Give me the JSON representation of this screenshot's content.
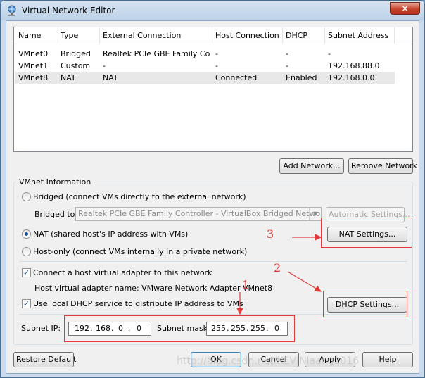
{
  "window": {
    "title": "Virtual Network Editor",
    "close_label": "×"
  },
  "table": {
    "columns": [
      "Name",
      "Type",
      "External Connection",
      "Host Connection",
      "DHCP",
      "Subnet Address"
    ],
    "rows": [
      [
        "VMnet0",
        "Bridged",
        "Realtek PCIe GBE Family Co...",
        "-",
        "-",
        "-"
      ],
      [
        "VMnet1",
        "Custom",
        "-",
        "-",
        "-",
        "192.168.88.0"
      ],
      [
        "VMnet8",
        "NAT",
        "NAT",
        "Connected",
        "Enabled",
        "192.168.0.0"
      ]
    ]
  },
  "buttons": {
    "add_network": "Add Network...",
    "remove_network": "Remove Network",
    "automatic_settings": "Automatic Settings...",
    "nat_settings": "NAT Settings...",
    "dhcp_settings": "DHCP Settings...",
    "restore_default": "Restore Default",
    "ok": "OK",
    "cancel": "Cancel",
    "apply": "Apply",
    "help": "Help"
  },
  "vmnet_info": {
    "group_label": "VMnet Information",
    "bridged_label": "Bridged (connect VMs directly to the external network)",
    "bridged_to_label": "Bridged to:",
    "bridged_to_value": "Realtek PCIe GBE Family Controller - VirtualBox Bridged Networking",
    "nat_label": "NAT (shared host's IP address with VMs)",
    "hostonly_label": "Host-only (connect VMs internally in a private network)",
    "connect_adapter_label": "Connect a host virtual adapter to this network",
    "adapter_name_label": "Host virtual adapter name: VMware Network Adapter VMnet8",
    "dhcp_label": "Use local DHCP service to distribute IP address to VMs",
    "subnet_ip_label": "Subnet IP:",
    "subnet_ip": [
      "192",
      "168",
      "0",
      "0"
    ],
    "subnet_mask_label": "Subnet mask:",
    "subnet_mask": [
      "255",
      "255",
      "255",
      "0"
    ],
    "selected_mode": "NAT",
    "connect_adapter_checked": true,
    "dhcp_checked": true
  },
  "annotations": {
    "one": "1",
    "two": "2",
    "three": "3",
    "color": "#e23a3a"
  },
  "watermark": "http://blog.csdn.net/KEVINlaang2016"
}
